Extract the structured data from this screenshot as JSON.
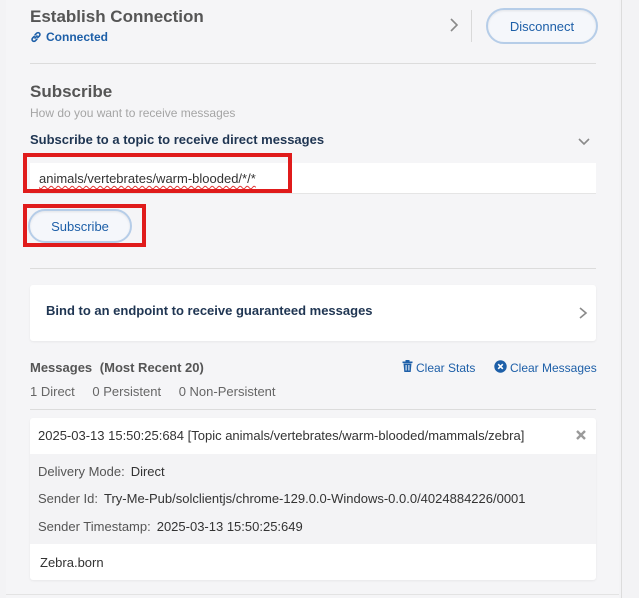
{
  "connection": {
    "title": "Establish Connection",
    "status": "Connected",
    "disconnect_label": "Disconnect"
  },
  "subscribe": {
    "title": "Subscribe",
    "subtitle": "How do you want to receive messages",
    "topic_section_label": "Subscribe to a topic to receive direct messages",
    "topic_value": "animals/vertebrates/warm-blooded/*/*",
    "subscribe_label": "Subscribe"
  },
  "bind": {
    "label": "Bind to an endpoint to receive guaranteed messages"
  },
  "messages": {
    "title": "Messages",
    "title_suffix": "(Most Recent 20)",
    "clear_stats_label": "Clear Stats",
    "clear_messages_label": "Clear Messages",
    "counts": {
      "direct": "1 Direct",
      "persistent": "0 Persistent",
      "non_persistent": "0 Non-Persistent"
    },
    "items": [
      {
        "header": "2025-03-13 15:50:25:684 [Topic animals/vertebrates/warm-blooded/mammals/zebra]",
        "delivery_mode_key": "Delivery Mode:",
        "delivery_mode_value": "Direct",
        "sender_id_key": "Sender Id:",
        "sender_id_value": "Try-Me-Pub/solclientjs/chrome-129.0.0-Windows-0.0.0/4024884226/0001",
        "sender_ts_key": "Sender Timestamp:",
        "sender_ts_value": "2025-03-13 15:50:25:649",
        "body": "Zebra.born"
      }
    ]
  },
  "colors": {
    "accent": "#1d5fa8",
    "highlight_box": "#e01b1b",
    "heading_dark": "#1f3552"
  }
}
